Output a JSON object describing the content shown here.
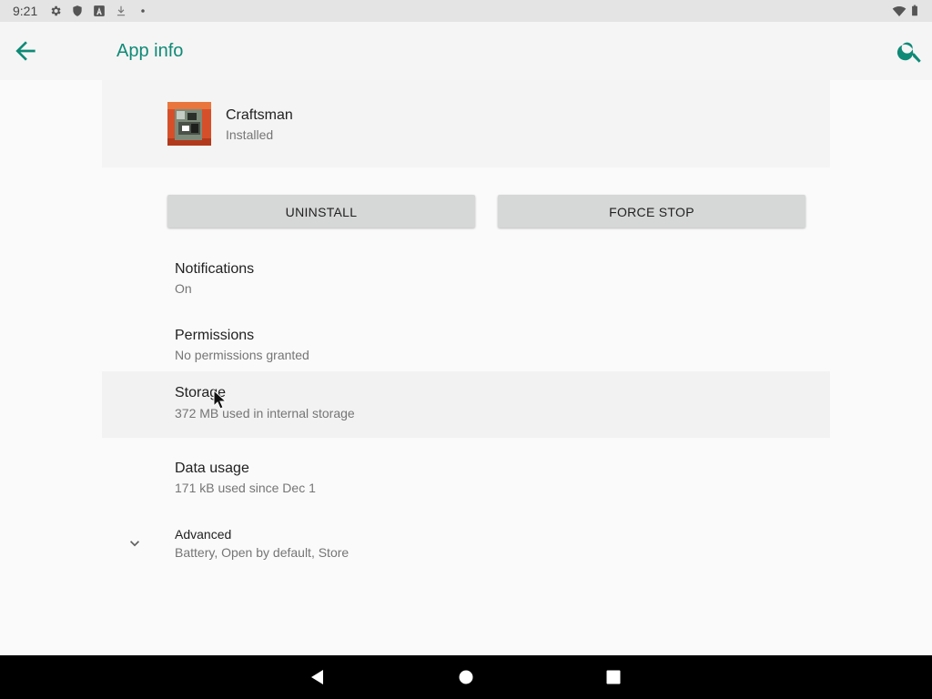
{
  "status_bar": {
    "time": "9:21",
    "icons": [
      "gear-icon",
      "shield-icon",
      "a-box-icon",
      "download-icon",
      "dot-icon",
      "wifi-icon"
    ]
  },
  "app_bar": {
    "title": "App info",
    "back_icon": "arrow-left-icon",
    "search_icon": "search-icon",
    "accent_color": "#0f8a76"
  },
  "app": {
    "name": "Craftsman",
    "status": "Installed",
    "icon": "craftsman-app-icon"
  },
  "actions": {
    "uninstall_label": "UNINSTALL",
    "force_stop_label": "FORCE STOP"
  },
  "prefs": [
    {
      "title": "Notifications",
      "summary": "On"
    },
    {
      "title": "Permissions",
      "summary": "No permissions granted"
    },
    {
      "title": "Storage",
      "summary": "372 MB used in internal storage"
    },
    {
      "title": "Data usage",
      "summary": "171 kB used since Dec 1"
    },
    {
      "title": "Advanced",
      "summary": "Battery, Open by default, Store"
    }
  ],
  "nav_bar": {
    "icons": [
      "back-triangle-icon",
      "home-circle-icon",
      "recents-square-icon"
    ]
  }
}
